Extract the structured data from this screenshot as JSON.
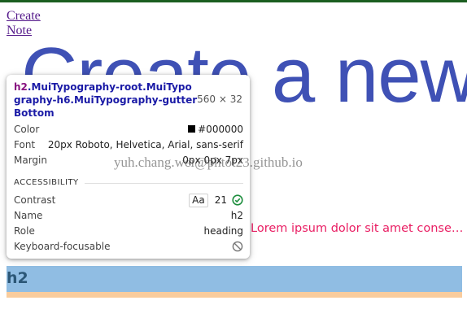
{
  "nav": {
    "create_label": "Create",
    "note_label": "Note"
  },
  "page": {
    "title": "Create a new note",
    "subtitle": "Lorem ipsum dolor sit amet consectetur adipisicing elit. Quos blanditiis tenetur",
    "h2_label": "h2"
  },
  "tooltip": {
    "selector_tag": "h2",
    "selector_classes": ".MuiTypography-root.MuiTypography-h6.MuiTypography-gutterBottom",
    "size": "560 × 32",
    "color_label": "Color",
    "color_value": "#000000",
    "font_label": "Font",
    "font_value": "20px Roboto, Helvetica, Arial, sans-serif",
    "margin_label": "Margin",
    "margin_value": "0px 0px 7px",
    "accessibility_heading": "ACCESSIBILITY",
    "contrast_label": "Contrast",
    "contrast_badge": "Aa",
    "contrast_value": "21",
    "name_label": "Name",
    "name_value": "h2",
    "role_label": "Role",
    "role_value": "heading",
    "focusable_label": "Keyboard-focusable"
  },
  "watermark": "yuh.chang.wei@phtot23.github.io",
  "colors": {
    "top_bar": "#1b5e20",
    "title": "#3f51b5",
    "subtitle": "#e91e63",
    "highlight_content": "#90bde3",
    "highlight_margin": "#f9cc9d",
    "contrast_ok": "#1e8e3e"
  },
  "icons": {
    "contrast_status": "check-circle-icon",
    "focusable_status": "block-icon"
  }
}
